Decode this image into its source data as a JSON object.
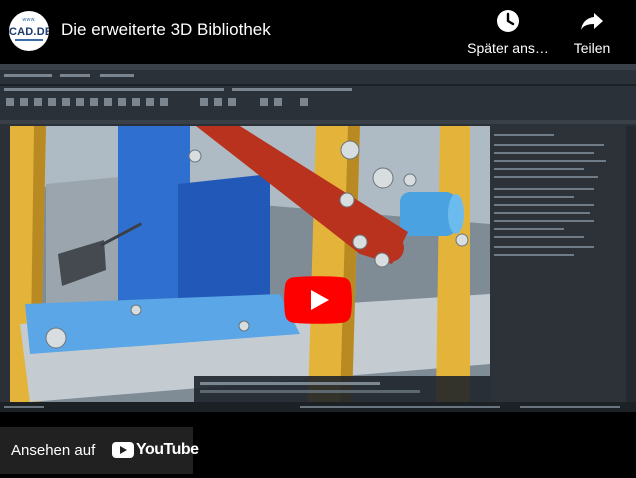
{
  "channel": {
    "logo_small": "www.",
    "logo_text": "CAD.DE"
  },
  "video": {
    "title": "Die erweiterte 3D Bibliothek"
  },
  "actions": {
    "watch_later": "Später ans…",
    "share": "Teilen"
  },
  "footer": {
    "watch_on": "Ansehen auf",
    "youtube": "YouTube"
  },
  "icons": {
    "watch_later": "clock-icon",
    "share": "share-arrow-icon",
    "play": "play-button-icon",
    "youtube": "youtube-logo-icon"
  },
  "colors": {
    "play_red": "#ff0000",
    "background": "#000000",
    "frame_bar": "#e8b83a",
    "link_red": "#b8321e"
  }
}
